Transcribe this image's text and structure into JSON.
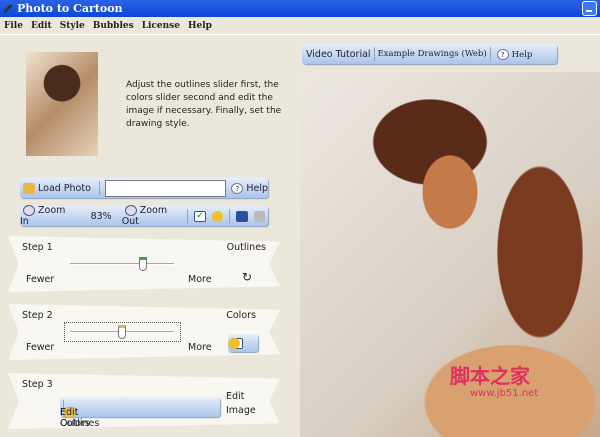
{
  "window": {
    "title": "Photo to Cartoon"
  },
  "menu": [
    "File",
    "Edit",
    "Style",
    "Bubbles",
    "License",
    "Help"
  ],
  "description": "Adjust the outlines slider first, the colors slider second and edit the image if necessary. Finally, set the drawing style.",
  "load_bar": {
    "load_label": "Load Photo",
    "path_value": "",
    "help_label": "Help"
  },
  "zoom_bar": {
    "zoom_in": "Zoom In",
    "zoom_level": "83%",
    "zoom_out": "Zoom Out"
  },
  "step1": {
    "label": "Step 1",
    "title": "Outlines",
    "min": "Fewer",
    "max": "More",
    "value": 0.7
  },
  "step2": {
    "label": "Step 2",
    "title": "Colors",
    "min": "Fewer",
    "max": "More",
    "value": 0.5
  },
  "step3": {
    "label": "Step 3",
    "title_line1": "Edit",
    "title_line2": "Image",
    "edit_outlines": "Edit Outlines",
    "edit_colors": "Edit Colors"
  },
  "top_toolbar": {
    "video": "Video Tutorial",
    "examples": "Example Drawings (Web)",
    "help": "Help"
  },
  "watermark": {
    "text": "脚本之家",
    "url": "www.jb51.net"
  }
}
